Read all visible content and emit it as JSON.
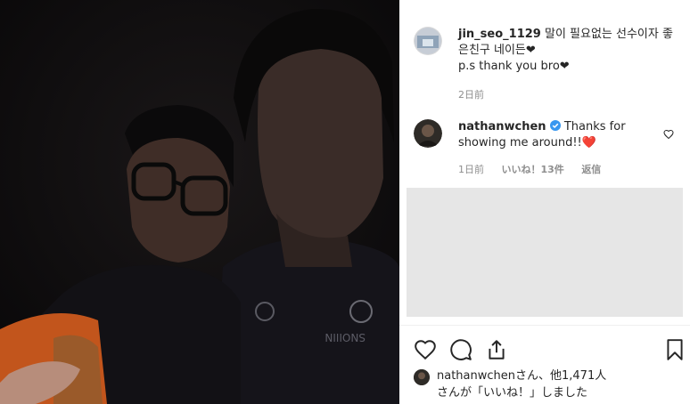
{
  "post": {
    "author": "jin_seo_1129",
    "caption_line1": "말이 필요없는 선수이자 좋",
    "caption_line2": "은친구 네이든❤",
    "caption_line3": "p.s thank you bro❤",
    "time": "2日前"
  },
  "comment": {
    "author": "nathanwchen",
    "verified_icon": "verified-badge-icon",
    "text_line1": "Thanks for",
    "text_line2": "showing me around!!❤️",
    "time": "1日前",
    "likes": "いいね！13件",
    "reply": "返信"
  },
  "actions": {
    "like_icon": "heart-icon",
    "comment_icon": "comment-icon",
    "share_icon": "share-icon",
    "save_icon": "bookmark-icon"
  },
  "likes_summary": {
    "line1": "nathanwchenさん、他1,471人",
    "line2": "さんが「いいね！」しました"
  },
  "colors": {
    "verified": "#3897f0",
    "muted_text": "#8e8e8e",
    "text": "#262626"
  }
}
